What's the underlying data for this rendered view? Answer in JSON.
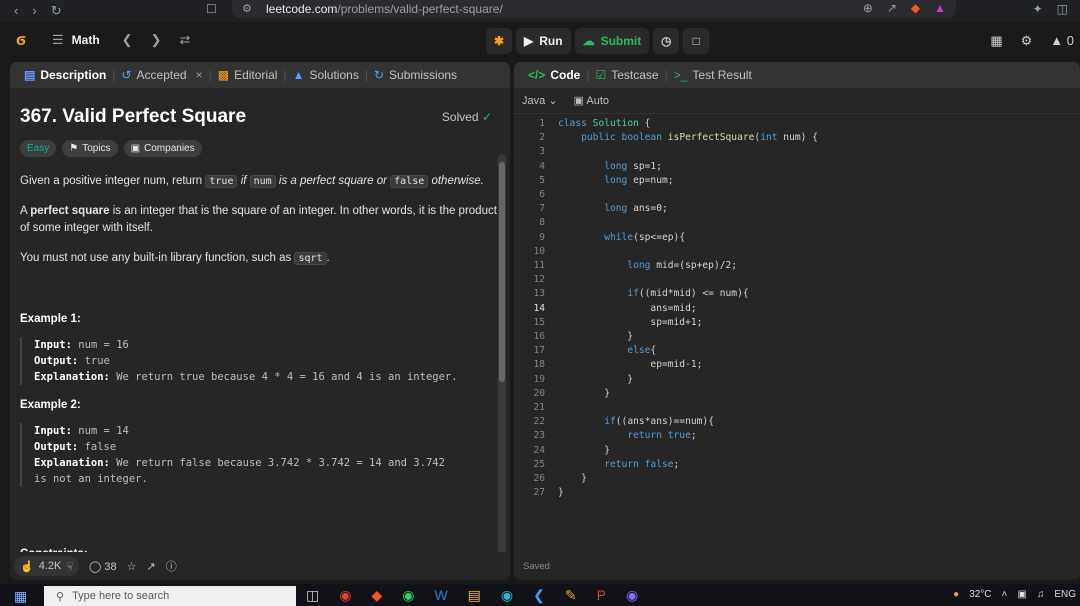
{
  "browser": {
    "host": "leetcode.com",
    "path": "/problems/valid-perfect-square/"
  },
  "topbar": {
    "problem_list": "Math",
    "run_label": "Run",
    "submit_label": "Submit",
    "premium_partial": "0"
  },
  "left_tabs": [
    {
      "label": "Description"
    },
    {
      "label": "Accepted"
    },
    {
      "label": "Editorial"
    },
    {
      "label": "Solutions"
    },
    {
      "label": "Submissions"
    }
  ],
  "problem": {
    "title": "367. Valid Perfect Square",
    "status": "Solved",
    "difficulty": "Easy",
    "topics_label": "Topics",
    "companies_label": "Companies",
    "p1_a": "Given a positive integer num, return",
    "p1_true": "true",
    "p1_if": "if",
    "p1_num": "num",
    "p1_mid": "is a perfect square or",
    "p1_false": "false",
    "p1_end": "otherwise.",
    "p2_a": "A",
    "p2_bold": "perfect square",
    "p2_b": "is an integer that is the square of an integer. In other words, it is the product of some integer with itself.",
    "p3_a": "You must not use any built-in library function, such as",
    "p3_code": "sqrt",
    "p3_end": ".",
    "ex1_title": "Example 1:",
    "ex1_input_label": "Input:",
    "ex1_input": "num = 16",
    "ex1_output_label": "Output:",
    "ex1_output": "true",
    "ex1_expl_label": "Explanation:",
    "ex1_expl": "We return true because 4 * 4 = 16 and 4 is an integer.",
    "ex2_title": "Example 2:",
    "ex2_input_label": "Input:",
    "ex2_input": "num = 14",
    "ex2_output_label": "Output:",
    "ex2_output": "false",
    "ex2_expl_label": "Explanation:",
    "ex2_expl_1": "We return false because 3.742 * 3.742 = 14 and 3.742",
    "ex2_expl_2": "is not an integer.",
    "constraints_title": "Constraints:"
  },
  "footer": {
    "likes": "4.2K",
    "comments": "38"
  },
  "right_tabs": [
    {
      "label": "Code"
    },
    {
      "label": "Testcase"
    },
    {
      "label": "Test Result"
    }
  ],
  "editor": {
    "language": "Java",
    "mode": "Auto",
    "current_line": "14",
    "status": "Saved"
  },
  "taskbar": {
    "search_placeholder": "Type here to search",
    "weather": "32°C",
    "lang": "ENG"
  }
}
